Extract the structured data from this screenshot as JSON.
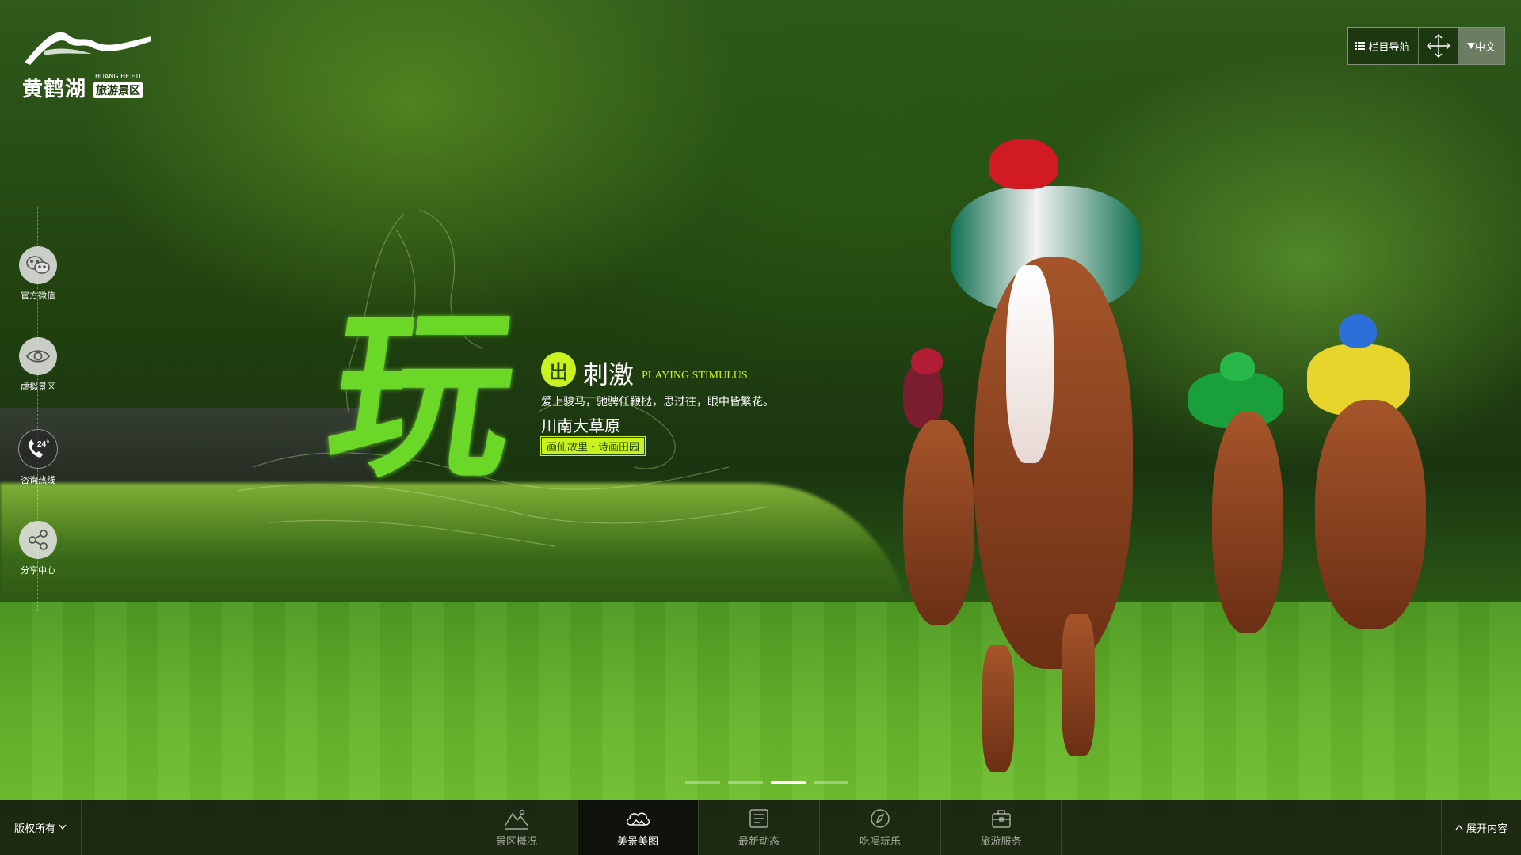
{
  "logo": {
    "name_cn": "黄鹤湖",
    "name_en": "HUANG HE HU",
    "subtitle": "旅游景区"
  },
  "topnav": {
    "column_nav": "栏目导航",
    "language": "中文",
    "icons": [
      "list-icon",
      "fullscreen-icon",
      "caret-down-icon"
    ]
  },
  "sidebar": {
    "items": [
      {
        "label": "官方微信",
        "icon": "wechat-icon"
      },
      {
        "label": "虚拟景区",
        "icon": "eye-icon"
      },
      {
        "label": "咨询热线",
        "icon": "hotline-24h-icon",
        "badge": "24h"
      },
      {
        "label": "分享中心",
        "icon": "share-icon"
      }
    ]
  },
  "slogan": {
    "big_char": "玩",
    "badge": "出",
    "headline": "刺激",
    "headline_en": "PLAYING STIMULUS",
    "tagline": "爱上骏马，驰骋任鞭挞，思过往，眼中皆繁花。",
    "place": "川南大草原",
    "place_tag": "画仙故里・诗画田园"
  },
  "carousel": {
    "slides": 4,
    "active_index": 2
  },
  "bottombar": {
    "copyright": "版权所有",
    "expand": "展开内容",
    "tabs": [
      {
        "label": "景区概况",
        "icon": "mountain-icon",
        "active": false
      },
      {
        "label": "美景美图",
        "icon": "cloud-icon",
        "active": true
      },
      {
        "label": "最新动态",
        "icon": "news-icon",
        "active": false
      },
      {
        "label": "吃喝玩乐",
        "icon": "compass-icon",
        "active": false
      },
      {
        "label": "旅游服务",
        "icon": "suitcase-icon",
        "active": false
      }
    ]
  },
  "colors": {
    "accent": "#c9f21f",
    "big_char": "#6bd827",
    "bar_bg": "#161c0e"
  }
}
